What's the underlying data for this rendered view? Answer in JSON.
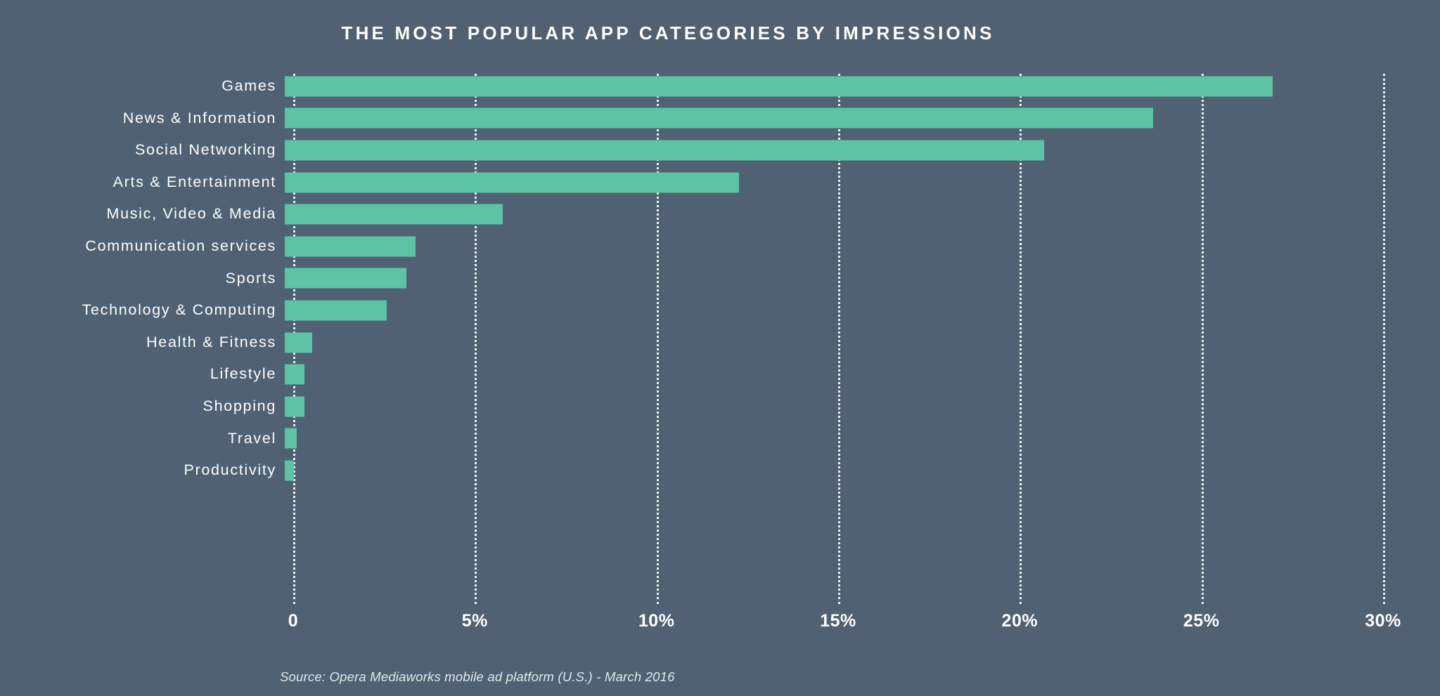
{
  "header": {
    "title": "THE MOST POPULAR APP CATEGORIES BY IMPRESSIONS"
  },
  "footer": {
    "source": "Source: Opera Mediaworks mobile ad platform (U.S.) - March 2016"
  },
  "colors": {
    "background": "#4f6173",
    "bar": "#5cc4a5",
    "text": "#ffffff",
    "gridline": "#ffffff"
  },
  "chart_data": {
    "type": "bar",
    "orientation": "horizontal",
    "title": "THE MOST POPULAR APP CATEGORIES BY IMPRESSIONS",
    "xlabel": "",
    "ylabel": "",
    "xlim": [
      0,
      30
    ],
    "grid": true,
    "legend": false,
    "unit": "%",
    "tick_labels": [
      "0",
      "5%",
      "10%",
      "15%",
      "20%",
      "25%",
      "30%"
    ],
    "tick_values": [
      0,
      5,
      10,
      15,
      20,
      25,
      30
    ],
    "categories": [
      "Games",
      "News & Information",
      "Social Networking",
      "Arts & Entertainment",
      "Music, Video & Media",
      "Communication services",
      "Sports",
      "Technology & Computing",
      "Health & Fitness",
      "Lifestyle",
      "Shopping",
      "Travel",
      "Productivity"
    ],
    "values": [
      27.2,
      23.9,
      20.9,
      12.5,
      6.0,
      3.6,
      3.35,
      2.8,
      0.75,
      0.55,
      0.55,
      0.33,
      0.25
    ]
  }
}
